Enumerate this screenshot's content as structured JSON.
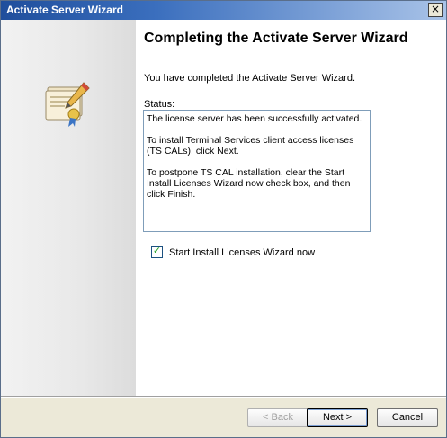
{
  "window": {
    "title": "Activate Server Wizard",
    "close_glyph": "×"
  },
  "left_panel": {
    "icon": "certificate-pen-icon"
  },
  "content": {
    "heading": "Completing the Activate Server Wizard",
    "intro": "You have completed the Activate Server Wizard.",
    "status_label": "Status:",
    "status_paragraphs": [
      "The license server has been successfully activated.",
      "To install Terminal Services client access licenses (TS CALs), click Next.",
      "To postpone TS CAL installation, clear the Start Install Licenses Wizard now check box, and then click Finish."
    ],
    "checkbox": {
      "label": "Start Install Licenses Wizard now",
      "checked": true,
      "mark": "✓"
    }
  },
  "buttons": {
    "back": "< Back",
    "next": "Next >",
    "cancel": "Cancel"
  },
  "colors": {
    "titlebar_start": "#1f4e9c",
    "titlebar_end": "#a9c3e8",
    "checkmark": "#21a121",
    "button_bar": "#ece9d8"
  }
}
